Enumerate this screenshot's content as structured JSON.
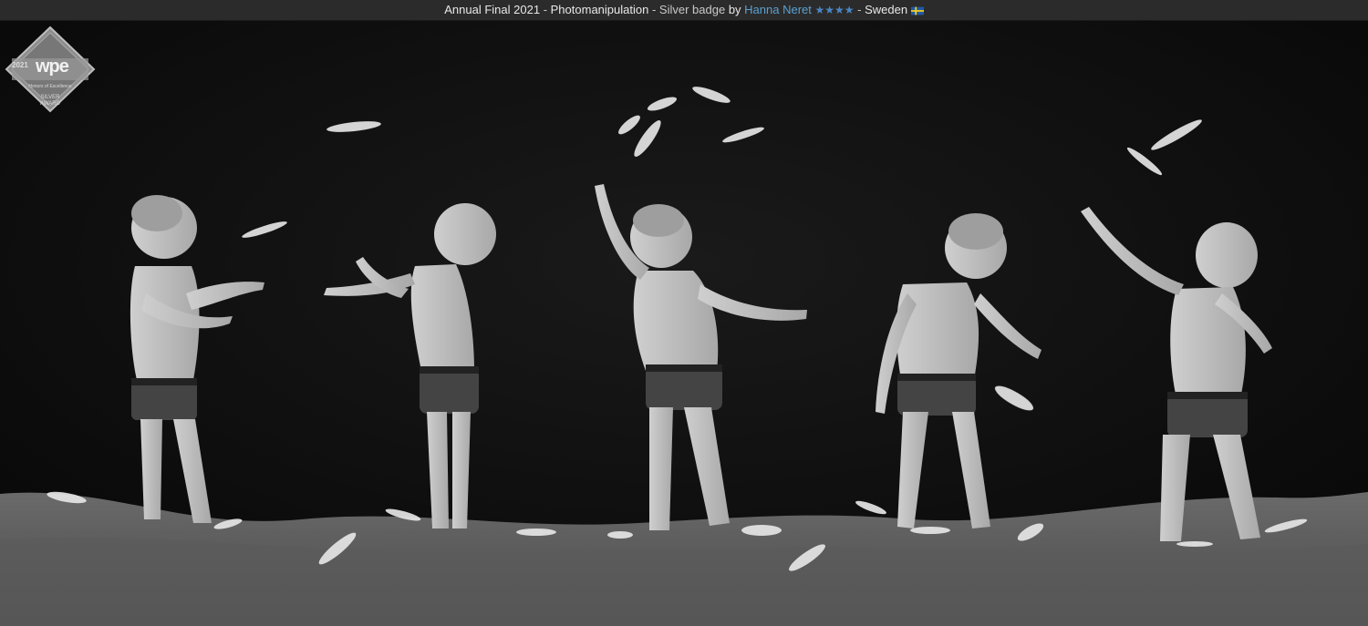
{
  "caption": {
    "competition": "Annual Final 2021",
    "category": "Photomanipulation",
    "award": "Silver badge",
    "by_label": "by",
    "author": "Hanna Neret",
    "author_stars": "★★★★",
    "country": "Sweden",
    "separator": " - ",
    "flag_colors": {
      "blue": "#1f5aa8",
      "yellow": "#f5cf1d"
    }
  },
  "badge": {
    "year": "2021",
    "logo": "wpe",
    "honor": "Honors of Excellence",
    "award_line1": "SILVER",
    "award_line2": "AWARD"
  },
  "photo": {
    "description_icon": "photo-image",
    "subject_count": 5
  }
}
